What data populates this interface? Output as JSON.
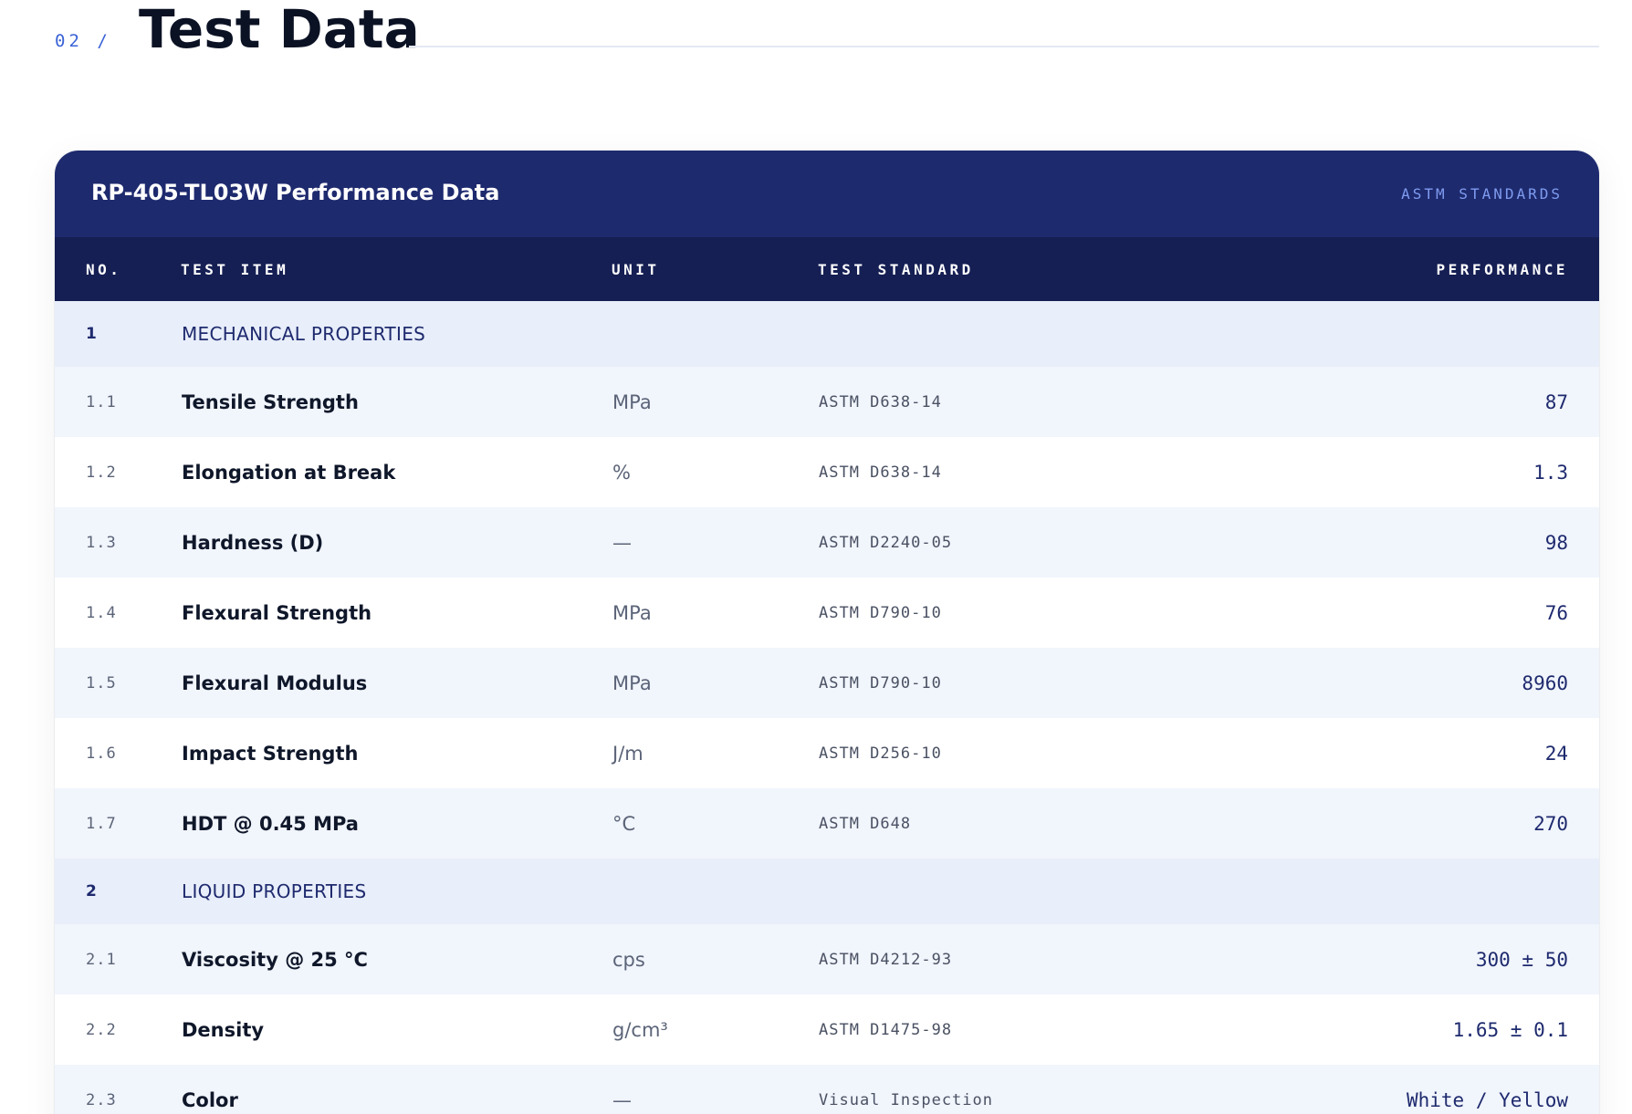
{
  "section": {
    "number": "02 /",
    "title": "Test Data"
  },
  "card": {
    "title": "RP-405-TL03W Performance Data",
    "tag": "ASTM STANDARDS"
  },
  "table": {
    "headers": {
      "no": "NO.",
      "item": "TEST ITEM",
      "unit": "UNIT",
      "standard": "TEST STANDARD",
      "performance": "PERFORMANCE"
    },
    "groups": [
      {
        "no": "1",
        "label": "MECHANICAL PROPERTIES",
        "rows": [
          {
            "no": "1.1",
            "item": "Tensile Strength",
            "unit": "MPa",
            "standard": "ASTM D638-14",
            "performance": "87"
          },
          {
            "no": "1.2",
            "item": "Elongation at Break",
            "unit": "%",
            "standard": "ASTM D638-14",
            "performance": "1.3"
          },
          {
            "no": "1.3",
            "item": "Hardness (D)",
            "unit": "—",
            "standard": "ASTM D2240-05",
            "performance": "98"
          },
          {
            "no": "1.4",
            "item": "Flexural Strength",
            "unit": "MPa",
            "standard": "ASTM D790-10",
            "performance": "76"
          },
          {
            "no": "1.5",
            "item": "Flexural Modulus",
            "unit": "MPa",
            "standard": "ASTM D790-10",
            "performance": "8960"
          },
          {
            "no": "1.6",
            "item": "Impact Strength",
            "unit": "J/m",
            "standard": "ASTM D256-10",
            "performance": "24"
          },
          {
            "no": "1.7",
            "item": "HDT @ 0.45 MPa",
            "unit": "°C",
            "standard": "ASTM D648",
            "performance": "270"
          }
        ]
      },
      {
        "no": "2",
        "label": "LIQUID PROPERTIES",
        "rows": [
          {
            "no": "2.1",
            "item": "Viscosity @ 25 °C",
            "unit": "cps",
            "standard": "ASTM D4212-93",
            "performance": "300 ± 50"
          },
          {
            "no": "2.2",
            "item": "Density",
            "unit": "g/cm³",
            "standard": "ASTM D1475-98",
            "performance": "1.65 ± 0.1"
          },
          {
            "no": "2.3",
            "item": "Color",
            "unit": "—",
            "standard": "Visual Inspection",
            "performance": "White / Yellow"
          }
        ]
      }
    ]
  }
}
